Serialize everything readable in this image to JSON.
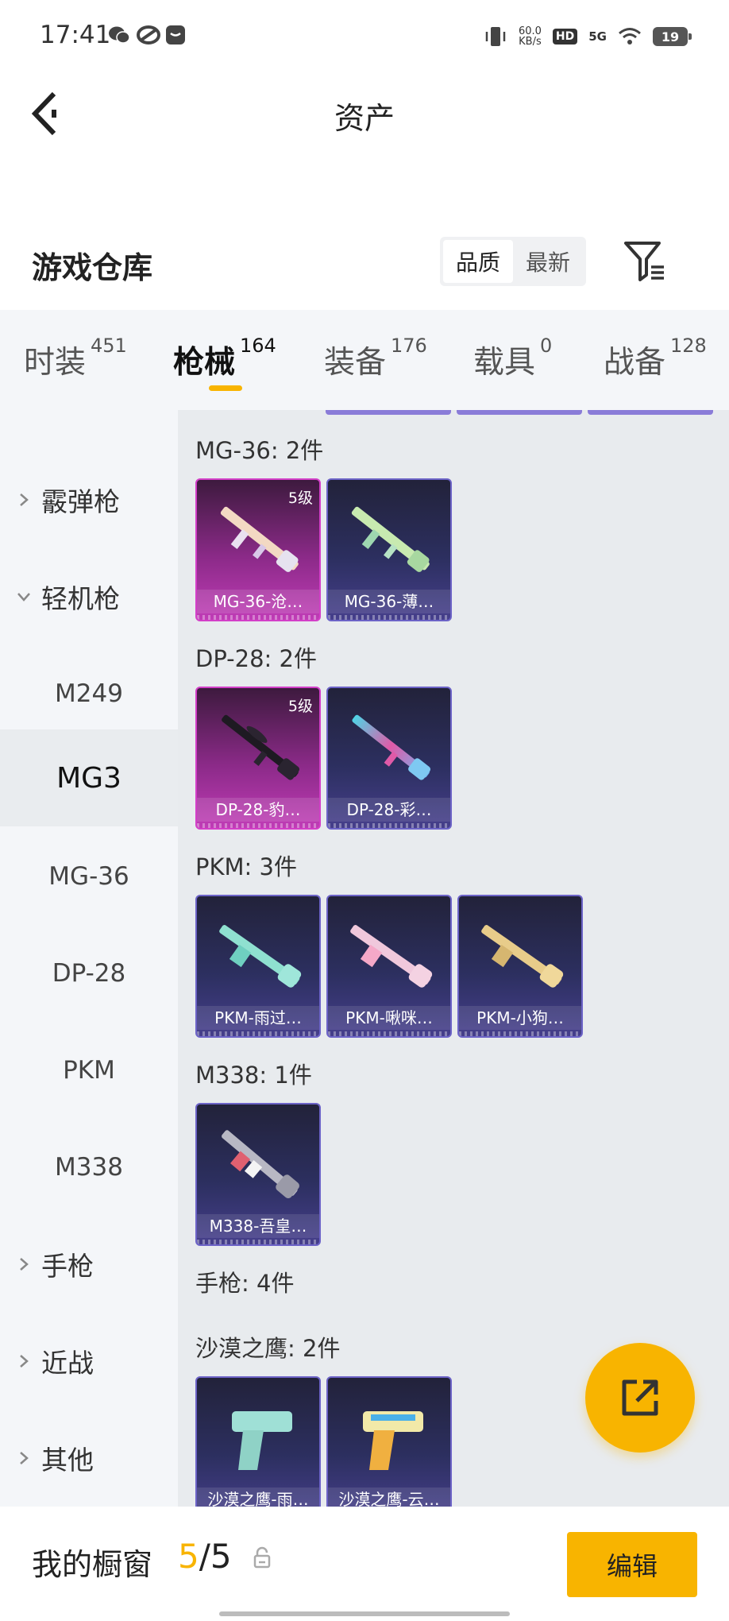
{
  "status_bar": {
    "time": "17:41",
    "net_speed_value": "60.0",
    "net_speed_unit": "KB/s",
    "hd": "HD",
    "network": "5G",
    "battery": "19",
    "icons": [
      "wechat-icon",
      "app-icon",
      "message-icon",
      "vibrate-icon",
      "signal-icon",
      "wifi-icon",
      "battery-icon"
    ]
  },
  "header": {
    "title": "资产",
    "back_icon": "chevron-left-icon"
  },
  "warehouse": {
    "title": "游戏仓库",
    "sort_options": [
      "品质",
      "最新"
    ],
    "sort_selected": "品质",
    "filter_icon": "filter-icon"
  },
  "tabs": [
    {
      "label": "时装",
      "count": "451"
    },
    {
      "label": "枪械",
      "count": "164",
      "active": true
    },
    {
      "label": "装备",
      "count": "176"
    },
    {
      "label": "载具",
      "count": "0"
    },
    {
      "label": "战备",
      "count": "128"
    }
  ],
  "sidebar": {
    "items": [
      {
        "label": "霰弹枪",
        "type": "group",
        "state": "collapsed"
      },
      {
        "label": "轻机枪",
        "type": "group",
        "state": "expanded"
      },
      {
        "label": "M249",
        "type": "sub"
      },
      {
        "label": "MG3",
        "type": "sub",
        "selected": true
      },
      {
        "label": "MG-36",
        "type": "sub"
      },
      {
        "label": "DP-28",
        "type": "sub"
      },
      {
        "label": "PKM",
        "type": "sub"
      },
      {
        "label": "M338",
        "type": "sub"
      },
      {
        "label": "手枪",
        "type": "group",
        "state": "collapsed"
      },
      {
        "label": "近战",
        "type": "group",
        "state": "collapsed"
      },
      {
        "label": "其他",
        "type": "group",
        "state": "collapsed"
      }
    ]
  },
  "content": {
    "groups": [
      {
        "label": "MG-36: 2件",
        "items": [
          {
            "name": "MG-36-沧…",
            "rarity": "pink",
            "level": "5级"
          },
          {
            "name": "MG-36-薄…",
            "rarity": "blue"
          }
        ]
      },
      {
        "label": "DP-28: 2件",
        "items": [
          {
            "name": "DP-28-豹…",
            "rarity": "pink",
            "level": "5级"
          },
          {
            "name": "DP-28-彩…",
            "rarity": "blue"
          }
        ]
      },
      {
        "label": "PKM: 3件",
        "items": [
          {
            "name": "PKM-雨过…",
            "rarity": "blue"
          },
          {
            "name": "PKM-啾咪…",
            "rarity": "blue"
          },
          {
            "name": "PKM-小狗…",
            "rarity": "blue"
          }
        ]
      },
      {
        "label": "M338: 1件",
        "items": [
          {
            "name": "M338-吾皇…",
            "rarity": "blue"
          }
        ]
      },
      {
        "label": "手枪: 4件",
        "items": []
      },
      {
        "label": "沙漠之鹰: 2件",
        "items": [
          {
            "name": "沙漠之鹰-雨…",
            "rarity": "blue"
          },
          {
            "name": "沙漠之鹰-云…",
            "rarity": "blue"
          }
        ]
      }
    ],
    "share_icon": "share-external-icon"
  },
  "showcase": {
    "label": "我的橱窗",
    "current": "5",
    "separator": "/",
    "total": "5",
    "lock_icon": "lock-icon",
    "edit_label": "编辑"
  },
  "colors": {
    "accent": "#f8b400",
    "card_blue": "#2c2f5f",
    "card_pink": "#c03cb6",
    "sidebar_bg": "#f4f6f9",
    "content_bg": "#e8ebee"
  }
}
